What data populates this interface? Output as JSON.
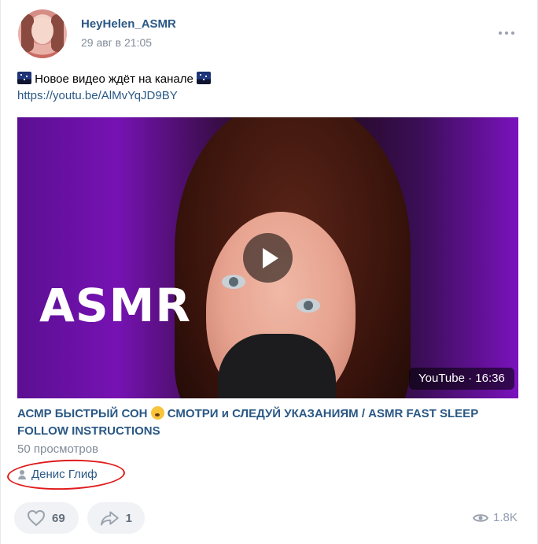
{
  "post": {
    "author": "HeyHelen_ASMR",
    "date": "29 авг в 21:05",
    "text": "Новое видео ждёт на канале",
    "link": "https://youtu.be/AlMvYqJD9BY",
    "signer": "Денис Глиф"
  },
  "video": {
    "thumbnail_text": "ASMR",
    "badge": "YouTube · 16:36",
    "title_part1": "АСМР БЫСТРЫЙ СОН",
    "title_part2": "СМОТРИ и СЛЕДУЙ УКАЗАНИЯМ / ASMR FAST SLEEP FOLLOW INSTRUCTIONS",
    "views": "50 просмотров"
  },
  "footer": {
    "likes": "69",
    "shares": "1",
    "views": "1.8K"
  },
  "colors": {
    "link": "#2a5885",
    "muted": "#818c99",
    "button_bg": "#f0f2f5",
    "annotation": "#e01b1b"
  }
}
